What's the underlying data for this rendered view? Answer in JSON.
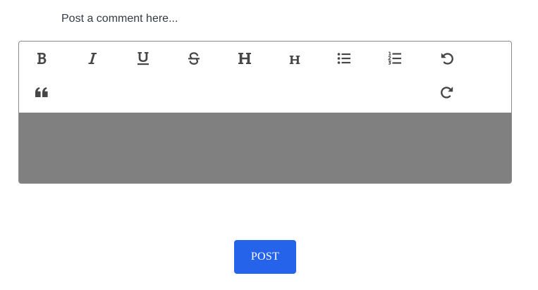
{
  "prompt": {
    "label": "Post a comment here..."
  },
  "toolbar": {
    "buttons": [
      {
        "name": "bold",
        "icon": "bold-icon"
      },
      {
        "name": "italic",
        "icon": "italic-icon"
      },
      {
        "name": "underline",
        "icon": "underline-icon"
      },
      {
        "name": "strikethrough",
        "icon": "strikethrough-icon"
      },
      {
        "name": "heading-large",
        "icon": "heading-large-icon"
      },
      {
        "name": "heading-small",
        "icon": "heading-small-icon"
      },
      {
        "name": "bulleted-list",
        "icon": "bulleted-list-icon"
      },
      {
        "name": "numbered-list",
        "icon": "numbered-list-icon"
      },
      {
        "name": "undo",
        "icon": "undo-icon"
      },
      {
        "name": "blockquote",
        "icon": "quote-icon"
      },
      {
        "name": "redo",
        "icon": "redo-icon"
      }
    ]
  },
  "editor": {
    "content": ""
  },
  "actions": {
    "post_label": "POST"
  },
  "colors": {
    "accent": "#2563eb",
    "icon": "#474747",
    "editor_area": "#808080",
    "border": "#8a8a8a"
  }
}
